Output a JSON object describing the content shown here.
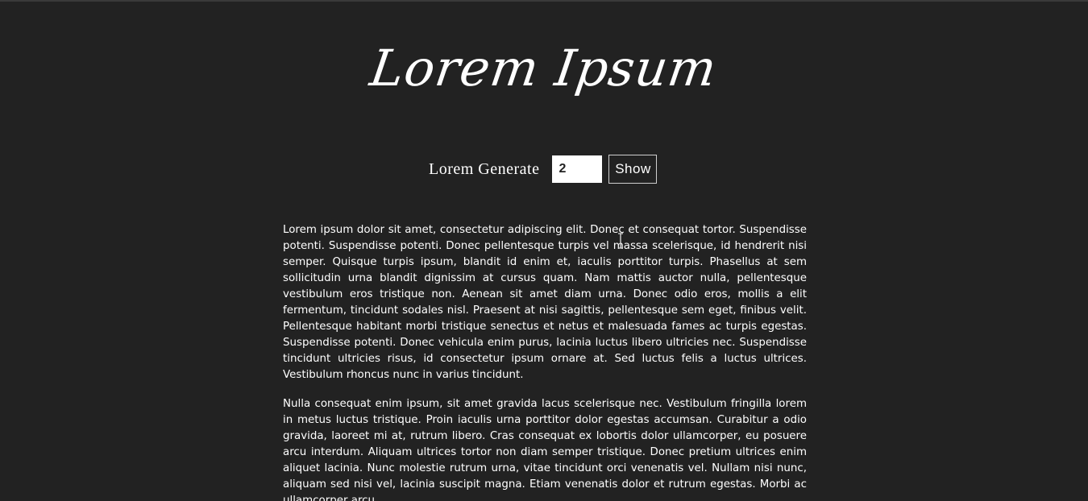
{
  "header": {
    "title": "Lorem Ipsum"
  },
  "generator": {
    "label": "Lorem Generate",
    "count_value": "2",
    "show_label": "Show"
  },
  "paragraphs": [
    "Lorem ipsum dolor sit amet, consectetur adipiscing elit. Donec et consequat tortor. Suspendisse potenti. Suspendisse potenti. Donec pellentesque turpis vel massa scelerisque, id hendrerit nisi semper. Quisque turpis ipsum, blandit id enim et, iaculis porttitor turpis. Phasellus at sem sollicitudin urna blandit dignissim at cursus quam. Nam mattis auctor nulla, pellentesque vestibulum eros tristique non. Aenean sit amet diam urna. Donec odio eros, mollis a elit fermentum, tincidunt sodales nisl. Praesent at nisi sagittis, pellentesque sem eget, finibus velit. Pellentesque habitant morbi tristique senectus et netus et malesuada fames ac turpis egestas. Suspendisse potenti. Donec vehicula enim purus, lacinia luctus libero ultricies nec. Suspendisse tincidunt ultricies risus, id consectetur ipsum ornare at. Sed luctus felis a luctus ultrices. Vestibulum rhoncus nunc in varius tincidunt.",
    "Nulla consequat enim ipsum, sit amet gravida lacus scelerisque nec. Vestibulum fringilla lorem in metus luctus tristique. Proin iaculis urna porttitor dolor egestas accumsan. Curabitur a odio gravida, laoreet mi at, rutrum libero. Cras consequat ex lobortis dolor ullamcorper, eu posuere arcu interdum. Aliquam ultrices tortor non diam semper tristique. Donec pretium ultrices enim aliquet lacinia. Nunc molestie rutrum urna, vitae tincidunt orci venenatis vel. Nullam nisi nunc, aliquam sed nisi vel, lacinia suscipit magna. Etiam venenatis dolor et rutrum egestas. Morbi ac ullamcorper arcu."
  ],
  "icons": {
    "cursor": "text-cursor-icon"
  },
  "colors": {
    "background": "#222222",
    "text": "#ffffff",
    "input_background": "#ffffff",
    "button_border": "#cfcfcf"
  }
}
